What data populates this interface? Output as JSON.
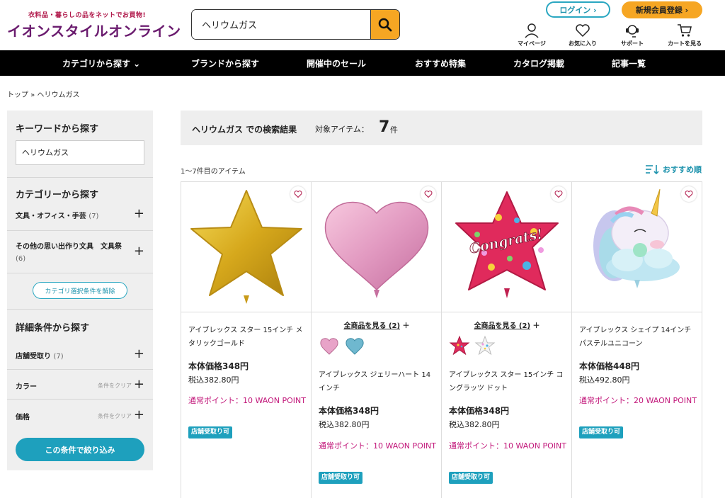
{
  "header": {
    "tagline": "衣料品・暮らしの品をネットでお買物!",
    "logo": "イオンスタイルオンライン",
    "search_value": "ヘリウムガス",
    "login_label": "ログイン ›",
    "register_label": "新規会員登録 ›",
    "icons": {
      "mypage": "マイページ",
      "favorites": "お気に入り",
      "support": "サポート",
      "cart": "カートを見る"
    }
  },
  "nav": {
    "categories": "カテゴリから探す ⌄",
    "brands": "ブランドから探す",
    "sales": "開催中のセール",
    "features": "おすすめ特集",
    "catalog": "カタログ掲載",
    "articles": "記事一覧"
  },
  "breadcrumb": "トップ » ヘリウムガス",
  "sidebar": {
    "keyword_heading": "キーワードから探す",
    "keyword_value": "ヘリウムガス",
    "category_heading": "カテゴリーから探す",
    "cat1_label": "文具・オフィス・手芸",
    "cat1_count": "(7)",
    "cat2_label": "その他の思い出作り文具　文具祭",
    "cat2_count": "(6)",
    "clear_category": "カテゴリ選択条件を解除",
    "detail_heading": "詳細条件から探す",
    "store_pickup_label": "店舗受取り",
    "store_pickup_count": "(7)",
    "color_label": "カラー",
    "price_label": "価格",
    "clear_small": "条件をクリア",
    "apply_label": "この条件で絞り込み"
  },
  "results": {
    "query_text": "ヘリウムガス での検索結果",
    "items_label": "対象アイテム：",
    "count": "7",
    "unit": "件",
    "range": "1〜7件目のアイテム",
    "sort": "おすすめ順"
  },
  "products": [
    {
      "name": "アイブレックス スター 15インチ メタリックゴールド",
      "price": "本体価格348円",
      "tax": "税込382.80円",
      "point": "通常ポイント：10 WAON POINT",
      "badge": "店舗受取り可"
    },
    {
      "see_all": "全商品を見る (2)",
      "name": "アイブレックス ジェリーハート 14インチ",
      "price": "本体価格348円",
      "tax": "税込382.80円",
      "point": "通常ポイント：10 WAON POINT",
      "badge": "店舗受取り可"
    },
    {
      "see_all": "全商品を見る (2)",
      "name": "アイブレックス スター 15インチ コングラッツ ドット",
      "price": "本体価格348円",
      "tax": "税込382.80円",
      "point": "通常ポイント：10 WAON POINT",
      "badge": "店舗受取り可",
      "image_text": "Congrats!"
    },
    {
      "name": "アイブレックス シェイプ 14インチ パステルユニコーン",
      "price": "本体価格448円",
      "tax": "税込492.80円",
      "point": "通常ポイント：20 WAON POINT",
      "badge": "店舗受取り可"
    }
  ],
  "colors": {
    "accent": "#1ea0bd",
    "orange": "#f6a623",
    "point": "#c2177a",
    "logo": "#6a1b6e"
  }
}
